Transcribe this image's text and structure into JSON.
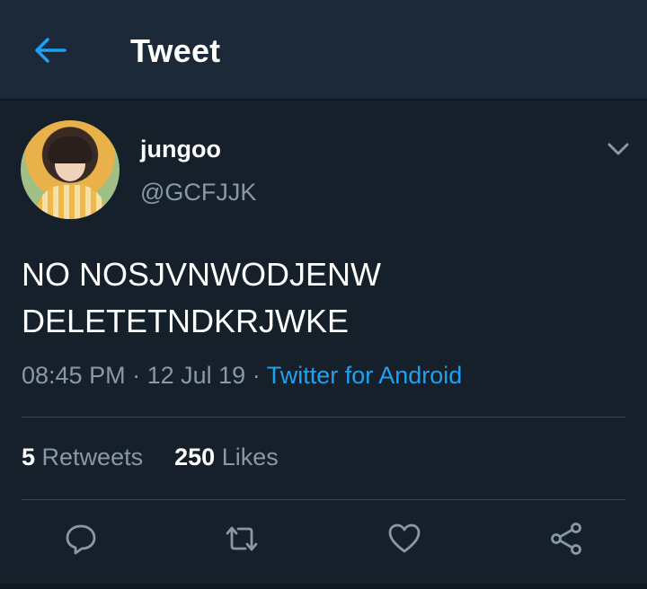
{
  "header": {
    "title": "Tweet",
    "back_icon": "arrow-left-icon"
  },
  "author": {
    "display_name": "jungoo",
    "handle": "@GCFJJK"
  },
  "tweet": {
    "text_line1": "NO NOSJVNWODJENW",
    "text_line2": "DELETETNDKRJWKE",
    "time": "08:45 PM",
    "date": "12 Jul 19",
    "source": "Twitter for Android"
  },
  "stats": {
    "retweets_count": "5",
    "retweets_label": "Retweets",
    "likes_count": "250",
    "likes_label": "Likes"
  },
  "colors": {
    "background": "#15202b",
    "header": "#1c2938",
    "accent": "#1da1f2",
    "muted": "#8899a6",
    "divider": "#38444d"
  }
}
